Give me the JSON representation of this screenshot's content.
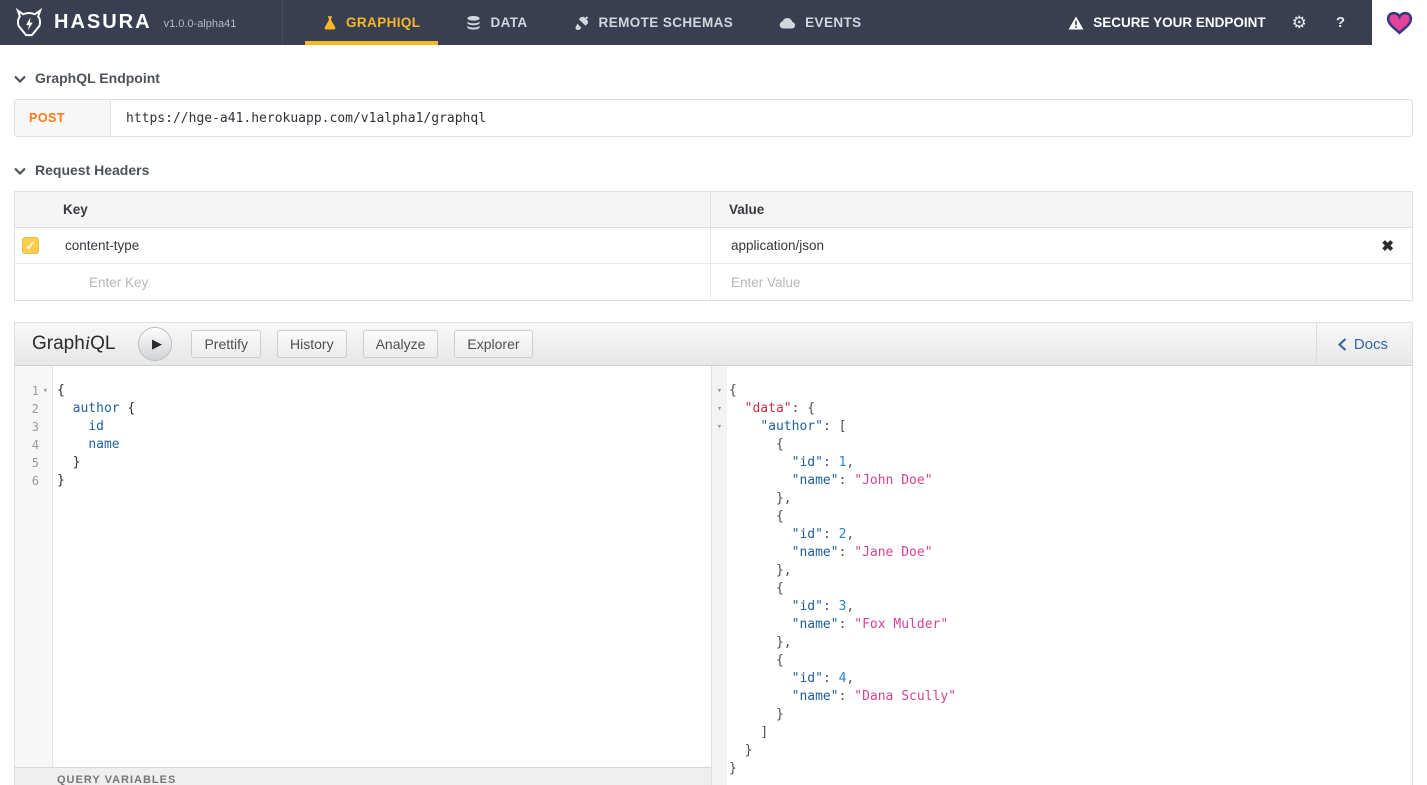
{
  "navbar": {
    "brand": "HASURA",
    "version": "v1.0.0-alpha41",
    "tabs": [
      {
        "label": "GRAPHIQL",
        "active": true
      },
      {
        "label": "DATA",
        "active": false
      },
      {
        "label": "REMOTE SCHEMAS",
        "active": false
      },
      {
        "label": "EVENTS",
        "active": false
      }
    ],
    "secure_endpoint_label": "SECURE YOUR ENDPOINT",
    "help_label": "?"
  },
  "endpoint": {
    "section_title": "GraphQL Endpoint",
    "method": "POST",
    "url": "https://hge-a41.herokuapp.com/v1alpha1/graphql"
  },
  "request_headers": {
    "section_title": "Request Headers",
    "key_column": "Key",
    "value_column": "Value",
    "rows": [
      {
        "key": "content-type",
        "value": "application/json",
        "enabled": true
      }
    ],
    "key_placeholder": "Enter Key",
    "value_placeholder": "Enter Value"
  },
  "graphiql": {
    "logo_graph": "Graph",
    "logo_i": "i",
    "logo_ql": "QL",
    "buttons": [
      "Prettify",
      "History",
      "Analyze",
      "Explorer"
    ],
    "docs_label": "Docs",
    "variables_title": "QUERY VARIABLES",
    "query": {
      "gutter_numbers": [
        "1",
        "2",
        "3",
        "4",
        "5",
        "6"
      ],
      "fold_lines": [
        1
      ],
      "lines": [
        [
          [
            "p",
            "{"
          ]
        ],
        [
          [
            "w",
            "  "
          ],
          [
            "f",
            "author"
          ],
          [
            "w",
            " "
          ],
          [
            "p",
            "{"
          ]
        ],
        [
          [
            "w",
            "    "
          ],
          [
            "f",
            "id"
          ]
        ],
        [
          [
            "w",
            "    "
          ],
          [
            "f",
            "name"
          ]
        ],
        [
          [
            "w",
            "  "
          ],
          [
            "p",
            "}"
          ]
        ],
        [
          [
            "p",
            "}"
          ]
        ]
      ]
    },
    "result": {
      "fold_lines": [
        1,
        2,
        3
      ],
      "lines": [
        [
          [
            "p",
            "{"
          ]
        ],
        [
          [
            "w",
            "  "
          ],
          [
            "k",
            "\"data\""
          ],
          [
            "p",
            ": {"
          ]
        ],
        [
          [
            "w",
            "    "
          ],
          [
            "q",
            "\"author\""
          ],
          [
            "p",
            ": ["
          ]
        ],
        [
          [
            "w",
            "      "
          ],
          [
            "p",
            "{"
          ]
        ],
        [
          [
            "w",
            "        "
          ],
          [
            "q",
            "\"id\""
          ],
          [
            "p",
            ": "
          ],
          [
            "n",
            "1"
          ],
          [
            "p",
            ","
          ]
        ],
        [
          [
            "w",
            "        "
          ],
          [
            "q",
            "\"name\""
          ],
          [
            "p",
            ": "
          ],
          [
            "s",
            "\"John Doe\""
          ]
        ],
        [
          [
            "w",
            "      "
          ],
          [
            "p",
            "},"
          ]
        ],
        [
          [
            "w",
            "      "
          ],
          [
            "p",
            "{"
          ]
        ],
        [
          [
            "w",
            "        "
          ],
          [
            "q",
            "\"id\""
          ],
          [
            "p",
            ": "
          ],
          [
            "n",
            "2"
          ],
          [
            "p",
            ","
          ]
        ],
        [
          [
            "w",
            "        "
          ],
          [
            "q",
            "\"name\""
          ],
          [
            "p",
            ": "
          ],
          [
            "s",
            "\"Jane Doe\""
          ]
        ],
        [
          [
            "w",
            "      "
          ],
          [
            "p",
            "},"
          ]
        ],
        [
          [
            "w",
            "      "
          ],
          [
            "p",
            "{"
          ]
        ],
        [
          [
            "w",
            "        "
          ],
          [
            "q",
            "\"id\""
          ],
          [
            "p",
            ": "
          ],
          [
            "n",
            "3"
          ],
          [
            "p",
            ","
          ]
        ],
        [
          [
            "w",
            "        "
          ],
          [
            "q",
            "\"name\""
          ],
          [
            "p",
            ": "
          ],
          [
            "s",
            "\"Fox Mulder\""
          ]
        ],
        [
          [
            "w",
            "      "
          ],
          [
            "p",
            "},"
          ]
        ],
        [
          [
            "w",
            "      "
          ],
          [
            "p",
            "{"
          ]
        ],
        [
          [
            "w",
            "        "
          ],
          [
            "q",
            "\"id\""
          ],
          [
            "p",
            ": "
          ],
          [
            "n",
            "4"
          ],
          [
            "p",
            ","
          ]
        ],
        [
          [
            "w",
            "        "
          ],
          [
            "q",
            "\"name\""
          ],
          [
            "p",
            ": "
          ],
          [
            "s",
            "\"Dana Scully\""
          ]
        ],
        [
          [
            "w",
            "      "
          ],
          [
            "p",
            "}"
          ]
        ],
        [
          [
            "w",
            "    "
          ],
          [
            "p",
            "]"
          ]
        ],
        [
          [
            "w",
            "  "
          ],
          [
            "p",
            "}"
          ]
        ],
        [
          [
            "p",
            "}"
          ]
        ]
      ]
    }
  },
  "icons": {
    "remove": "✖",
    "check": "✓",
    "play": "▶",
    "fold": "▾"
  },
  "colors": {
    "navbar_bg": "#393e51",
    "accent_yellow": "#f8b826",
    "post_orange": "#ff791a",
    "docs_blue": "#3267a8",
    "field_blue": "#1f61a0",
    "key_red": "#cb2d44",
    "number_blue": "#2882d9",
    "string_pink": "#d64292"
  }
}
